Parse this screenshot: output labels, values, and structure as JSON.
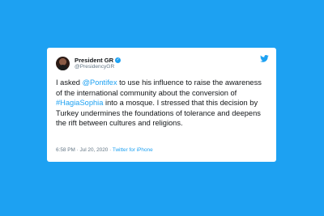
{
  "tweet": {
    "author_name": "President GR",
    "handle": "@PresidencyGR",
    "verified_mark": "✓",
    "text_parts": {
      "p1": "I asked ",
      "mention": "@Pontifex",
      "p2": " to use his influence to raise the awareness of the international community about the conversion of ",
      "hashtag": "#HagiaSophia",
      "p3": " into a mosque. I stressed that this decision by Turkey undermines the foundations of tolerance and deepens the rift between cultures and religions."
    },
    "timestamp": "6:58 PM · Jul 20, 2020",
    "separator": " · ",
    "source": "Twitter for iPhone"
  },
  "colors": {
    "background": "#1da1f2",
    "card": "#ffffff",
    "link": "#1da1f2",
    "text": "#14171a",
    "muted": "#657786"
  },
  "icons": {
    "verified": "verified-badge-icon",
    "logo": "twitter-bird-icon"
  }
}
